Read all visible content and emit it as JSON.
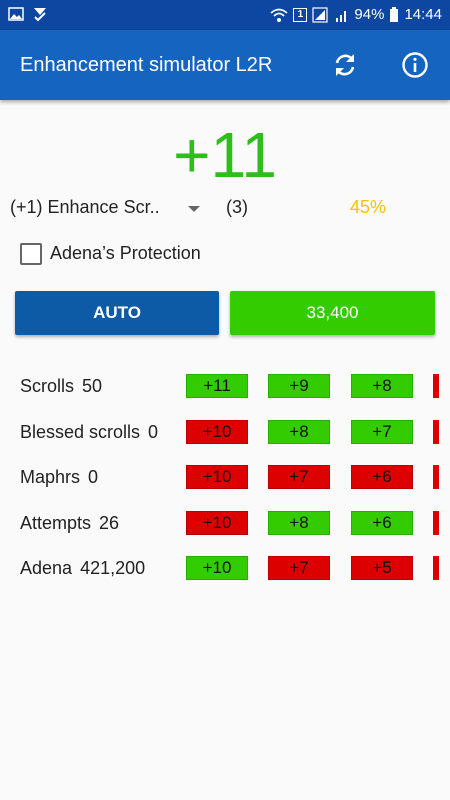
{
  "status_bar": {
    "sim_label": "1",
    "battery": "94%",
    "time": "14:44"
  },
  "app_bar": {
    "title": "Enhancement simulator L2R",
    "icons": [
      "refresh-icon",
      "info-icon"
    ]
  },
  "current_level": "+11",
  "scroll_select": {
    "value": "(+1) Enhance Scr..",
    "count": "(3)",
    "chance": "45%"
  },
  "protection": {
    "label": "Adena’s Protection",
    "checked": false
  },
  "buttons": {
    "auto": "AUTO",
    "enhance": "33,400"
  },
  "stats": [
    {
      "label": "Scrolls",
      "value": "50",
      "history": [
        {
          "text": "+11",
          "result": "success"
        },
        {
          "text": "+9",
          "result": "success"
        },
        {
          "text": "+8",
          "result": "success"
        }
      ]
    },
    {
      "label": "Blessed scrolls",
      "value": "0",
      "history": [
        {
          "text": "+10",
          "result": "fail"
        },
        {
          "text": "+8",
          "result": "success"
        },
        {
          "text": "+7",
          "result": "success"
        }
      ]
    },
    {
      "label": "Maphrs",
      "value": "0",
      "history": [
        {
          "text": "+10",
          "result": "fail"
        },
        {
          "text": "+7",
          "result": "fail"
        },
        {
          "text": "+6",
          "result": "fail"
        }
      ]
    },
    {
      "label": "Attempts",
      "value": "26",
      "history": [
        {
          "text": "+10",
          "result": "fail"
        },
        {
          "text": "+8",
          "result": "success"
        },
        {
          "text": "+6",
          "result": "success"
        }
      ]
    },
    {
      "label": "Adena",
      "value": "421,200",
      "history": [
        {
          "text": "+10",
          "result": "success"
        },
        {
          "text": "+7",
          "result": "fail"
        },
        {
          "text": "+5",
          "result": "fail"
        }
      ]
    }
  ],
  "colors": {
    "app_bar": "#1565c0",
    "status_bar": "#0d47a1",
    "level_green": "#2ebd1a",
    "chance_yellow": "#f4c20d",
    "success": "#33cc00",
    "fail": "#dd0000",
    "auto_button": "#0d5aa7"
  }
}
